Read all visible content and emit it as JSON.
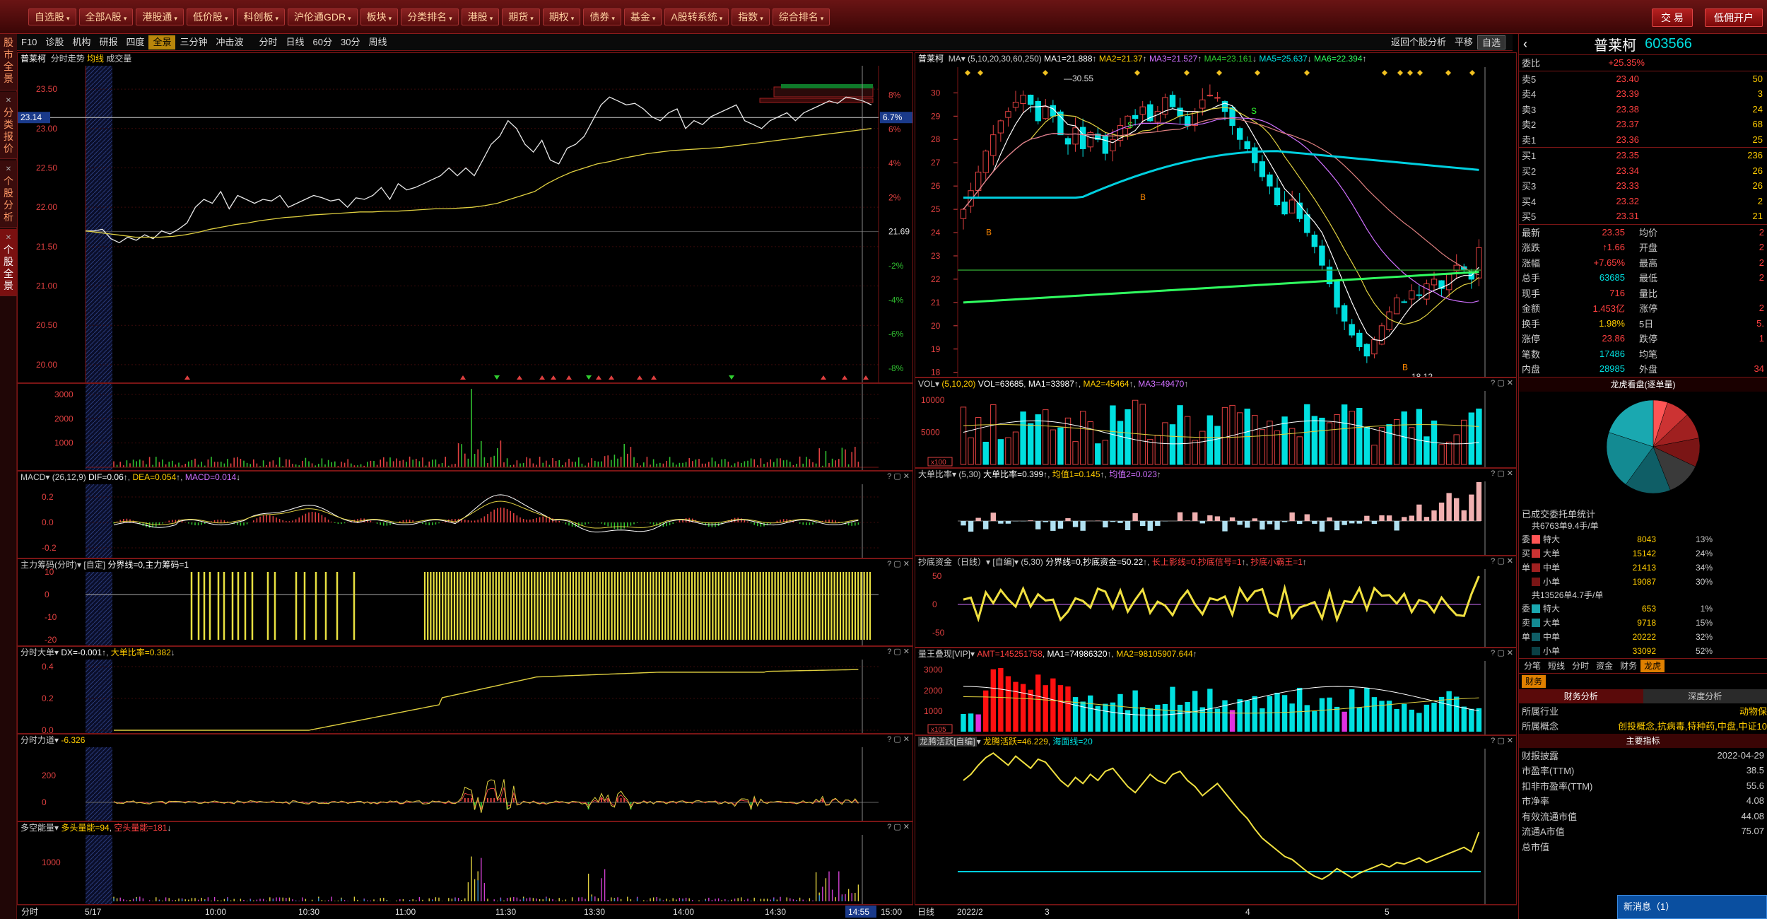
{
  "app": {
    "title": "",
    "menus": [
      "自选股",
      "全部A股",
      "港股通",
      "低价股",
      "科创板",
      "沪伦通GDR",
      "板块",
      "分类排名",
      "港股",
      "期货",
      "期权",
      "债券",
      "基金",
      "A股转系统",
      "指数",
      "综合排名"
    ],
    "trade_btn": "交 易",
    "low_commission_btn": "低佣开户"
  },
  "left_rail": [
    {
      "label": "股市全景"
    },
    {
      "label": "分类报价"
    },
    {
      "label": "个股分析"
    },
    {
      "label": "个股全景"
    }
  ],
  "toolbar": {
    "left": [
      "F10",
      "诊股",
      "机构",
      "研报",
      "四度",
      "全景",
      "三分钟",
      "冲击波"
    ],
    "period": [
      "分时",
      "日线",
      "60分",
      "30分",
      "周线"
    ],
    "right": [
      "返回个股分析",
      "平移",
      "自选"
    ]
  },
  "intraday": {
    "title": "普莱柯",
    "subtitle": "分时走势",
    "avg_label": "均线",
    "vol_label": "成交量",
    "cur_price": "23.14",
    "cur_pct": "6.7%",
    "ref": "21.69",
    "left_ticks": [
      "23.50",
      "23.00",
      "22.50",
      "22.00",
      "21.50",
      "21.00",
      "20.50",
      "20.00"
    ],
    "right_ticks": [
      "8%",
      "6%",
      "4%",
      "2%",
      "-2%",
      "-4%",
      "-6%",
      "-8%"
    ],
    "vol_ticks": [
      "3000",
      "2000",
      "1000"
    ],
    "price_series": [
      21.7,
      21.7,
      21.72,
      21.6,
      21.55,
      21.62,
      21.58,
      21.65,
      21.6,
      21.7,
      21.66,
      21.72,
      21.8,
      22.0,
      22.1,
      22.05,
      22.2,
      21.98,
      22.15,
      22.1,
      22.05,
      22.1,
      22.08,
      22.15,
      22.0,
      22.05,
      22.1,
      22.15,
      22.12,
      22.08,
      22.1,
      22.0,
      22.12,
      22.1,
      22.15,
      22.25,
      22.1,
      22.3,
      22.22,
      22.25,
      22.3,
      22.35,
      22.4,
      22.5,
      22.4,
      22.5,
      22.4,
      22.6,
      22.8,
      22.9,
      23.1,
      23.0,
      22.8,
      22.7,
      22.85,
      22.6,
      22.55,
      22.75,
      22.8,
      22.9,
      23.1,
      23.3,
      23.4,
      23.35,
      23.3,
      23.32,
      23.25,
      23.15,
      23.1,
      23.2,
      23.25,
      23.0,
      23.1,
      23.05,
      23.15,
      23.2,
      23.25,
      23.3,
      23.1,
      23.05,
      23.0,
      23.1,
      23.15,
      23.2,
      23.1,
      23.2,
      23.25,
      23.3,
      23.35,
      23.32,
      23.4,
      23.38,
      23.35,
      23.3
    ],
    "avg_series": [
      21.7,
      21.68,
      21.66,
      21.64,
      21.62,
      21.62,
      21.62,
      21.63,
      21.65,
      21.68,
      21.72,
      21.75,
      21.78,
      21.8,
      21.83,
      21.85,
      21.87,
      21.88,
      21.9,
      21.91,
      21.92,
      21.93,
      21.94,
      21.94,
      21.95,
      21.95,
      21.96,
      21.97,
      21.98,
      21.98,
      21.99,
      22.0,
      22.02,
      22.05,
      22.1,
      22.15,
      22.2,
      22.3,
      22.38,
      22.45,
      22.5,
      22.55,
      22.58,
      22.62,
      22.65,
      22.68,
      22.7,
      22.72,
      22.73,
      22.74,
      22.75,
      22.76,
      22.78,
      22.8,
      22.82,
      22.84,
      22.86,
      22.88,
      22.9,
      22.92,
      22.94,
      22.96,
      22.98,
      23.0
    ]
  },
  "macd": {
    "label": "MACD",
    "params": "(26,12,9)",
    "dif": "DIF=0.06",
    "dea": "DEA=0.054",
    "macd": "MACD=0.014",
    "ticks": [
      "0.2",
      "0.0",
      "-0.2"
    ]
  },
  "chips": {
    "label": "主力筹码(分时)",
    "extra": "[自定]",
    "threshold": "分界线=0,主力筹码=1",
    "ticks": [
      "10",
      "0",
      "-10",
      "-20"
    ]
  },
  "bigorder": {
    "label": "分时大单",
    "dx": "DX=-0.001",
    "ratio": "大单比率=0.382",
    "ticks": [
      "0.4",
      "0.2",
      "0.0"
    ]
  },
  "force": {
    "label": "分时力道",
    "value": "-6.326",
    "ticks": [
      "200",
      "0",
      "-200"
    ]
  },
  "energy": {
    "label": "多空能量",
    "bull": "多头量能=94",
    "bear": "空头量能=181",
    "ticks": [
      "1000"
    ]
  },
  "time_axis": {
    "left": "分时",
    "labels": [
      "5/17",
      "10:00",
      "10:30",
      "11:00",
      "11:30",
      "13:30",
      "14:00",
      "14:30",
      "14:55",
      "15:00"
    ]
  },
  "daily": {
    "title": "普莱柯",
    "ma_label": "MA",
    "params": "(5,10,20,30,60,250)",
    "ma1": "MA1=21.888",
    "ma2": "MA2=21.37",
    "ma3": "MA3=21.527",
    "ma4": "MA4=23.161",
    "ma5": "MA5=25.637",
    "ma6": "MA6=22.394",
    "high_mark": "30.55",
    "low_mark": "18.12",
    "ticks": [
      "30",
      "29",
      "28",
      "27",
      "26",
      "25",
      "24",
      "23",
      "22",
      "21",
      "20",
      "19",
      "18"
    ],
    "vol": {
      "label": "VOL",
      "params": "(5,10,20)",
      "v": "VOL=63685",
      "m1": "MA1=33987",
      "m2": "MA2=45464",
      "m3": "MA3=49470",
      "ticks": [
        "10000",
        "5000"
      ],
      "unit": "x100"
    },
    "bigratio": {
      "label": "大单比率",
      "params": "(5,30)",
      "v": "大单比率=0.399",
      "m1": "均值1=0.145",
      "m2": "均值2=0.023"
    },
    "bottom": {
      "label": "抄底资金（日线）",
      "extra": "[自编]",
      "params": "(5,30)",
      "v": "分界线=0,抄底资金=50.22",
      "s": "长上影线=0,抄底信号=1",
      "w": "抄底小霸王=1",
      "ticks": [
        "50",
        "0",
        "-50"
      ]
    },
    "amt": {
      "label": "量王叠现[VIP]",
      "v": "AMT=145251758",
      "m1": "MA1=74986320",
      "m2": "MA2=98105907.644",
      "ticks": [
        "3000",
        "2000",
        "1000"
      ],
      "unit": "x105"
    },
    "dragon": {
      "label": "龙腾活跃[自编]",
      "v": "龙腾活跃=46.229",
      "m": "海面线=20"
    },
    "axis": {
      "left": "日线",
      "labels": [
        "2022/2",
        "3",
        "4",
        "5"
      ]
    }
  },
  "quote": {
    "name": "普莱柯",
    "code": "603566",
    "wb_label": "委比",
    "wb_val": "+25.35%",
    "wc_label": "委差",
    "wc_val": "",
    "asks": [
      {
        "l": "卖5",
        "p": "23.40",
        "v": "50"
      },
      {
        "l": "卖4",
        "p": "23.39",
        "v": "3"
      },
      {
        "l": "卖3",
        "p": "23.38",
        "v": "24"
      },
      {
        "l": "卖2",
        "p": "23.37",
        "v": "68"
      },
      {
        "l": "卖1",
        "p": "23.36",
        "v": "25"
      }
    ],
    "bids": [
      {
        "l": "买1",
        "p": "23.35",
        "v": "236"
      },
      {
        "l": "买2",
        "p": "23.34",
        "v": "26"
      },
      {
        "l": "买3",
        "p": "23.33",
        "v": "26"
      },
      {
        "l": "买4",
        "p": "23.32",
        "v": "2"
      },
      {
        "l": "买5",
        "p": "23.31",
        "v": "21"
      }
    ],
    "stats": [
      {
        "a": "最新",
        "b": "23.35",
        "c": "均价",
        "d": "2"
      },
      {
        "a": "涨跌",
        "b": "↑1.66",
        "c": "开盘",
        "d": "2"
      },
      {
        "a": "涨幅",
        "b": "+7.65%",
        "c": "最高",
        "d": "2"
      },
      {
        "a": "总手",
        "b": "63685",
        "c": "最低",
        "d": "2"
      },
      {
        "a": "现手",
        "b": "716",
        "c": "量比",
        "d": ""
      },
      {
        "a": "金额",
        "b": "1.453亿",
        "c": "涨停",
        "d": "2"
      },
      {
        "a": "换手",
        "b": "1.98%",
        "c": "5日",
        "d": "5."
      },
      {
        "a": "涨停",
        "b": "23.86",
        "c": "跌停",
        "d": "1"
      },
      {
        "a": "笔数",
        "b": "17486",
        "c": "均笔",
        "d": ""
      },
      {
        "a": "内盘",
        "b": "28985",
        "c": "外盘",
        "d": "34"
      }
    ]
  },
  "donut": {
    "title": "龙虎看盘(逐单量)",
    "slices": [
      {
        "v": 5,
        "c": "#ff5555"
      },
      {
        "v": 8,
        "c": "#cc3333"
      },
      {
        "v": 9,
        "c": "#a02020"
      },
      {
        "v": 10,
        "c": "#7a1515"
      },
      {
        "v": 12,
        "c": "#3a3a3a"
      },
      {
        "v": 16,
        "c": "#0f5e66"
      },
      {
        "v": 20,
        "c": "#138a92"
      },
      {
        "v": 20,
        "c": "#1aa8b0"
      }
    ]
  },
  "orders": {
    "title": "已成交委托单统计",
    "buy_head": "共6763单9.4手/单",
    "sell_head": "共13526单4.7手/单",
    "buy": [
      {
        "k": "特大",
        "v": "8043",
        "p": "13%",
        "c": "#ff5555"
      },
      {
        "k": "大单",
        "v": "15142",
        "p": "24%",
        "c": "#cc3333"
      },
      {
        "k": "中单",
        "v": "21413",
        "p": "34%",
        "c": "#a02020"
      },
      {
        "k": "小单",
        "v": "19087",
        "p": "30%",
        "c": "#7a1515"
      }
    ],
    "sell": [
      {
        "k": "特大",
        "v": "653",
        "p": "1%",
        "c": "#1aa8b0"
      },
      {
        "k": "大单",
        "v": "9718",
        "p": "15%",
        "c": "#138a92"
      },
      {
        "k": "中单",
        "v": "20222",
        "p": "32%",
        "c": "#0f5e66"
      },
      {
        "k": "小单",
        "v": "33092",
        "p": "52%",
        "c": "#0a3f44"
      }
    ],
    "buy_side": [
      "委",
      "买",
      "单"
    ],
    "sell_side": [
      "委",
      "卖",
      "单"
    ]
  },
  "bottom_tabs": [
    "分笔",
    "短线",
    "分时",
    "资金",
    "财务",
    "龙虎"
  ],
  "finance": {
    "tab": "财务",
    "analysis": "财务分析",
    "deep": "深度分析",
    "industry_label": "所属行业",
    "industry": "动物保",
    "concept_label": "所属概念",
    "concept": "创投概念,抗病毒,特种药,中盘,中证10",
    "key": "主要指标",
    "rows": [
      {
        "k": "财报披露",
        "v": "2022-04-29"
      },
      {
        "k": "市盈率(TTM)",
        "v": "38.5"
      },
      {
        "k": "扣非市盈率(TTM)",
        "v": "55.6"
      },
      {
        "k": "市净率",
        "v": "4.08"
      },
      {
        "k": "有效流通市值",
        "v": "44.08"
      },
      {
        "k": "流通A市值",
        "v": "75.07"
      },
      {
        "k": "总市值",
        "v": ""
      }
    ]
  },
  "news": {
    "label": "新消息（1）"
  }
}
